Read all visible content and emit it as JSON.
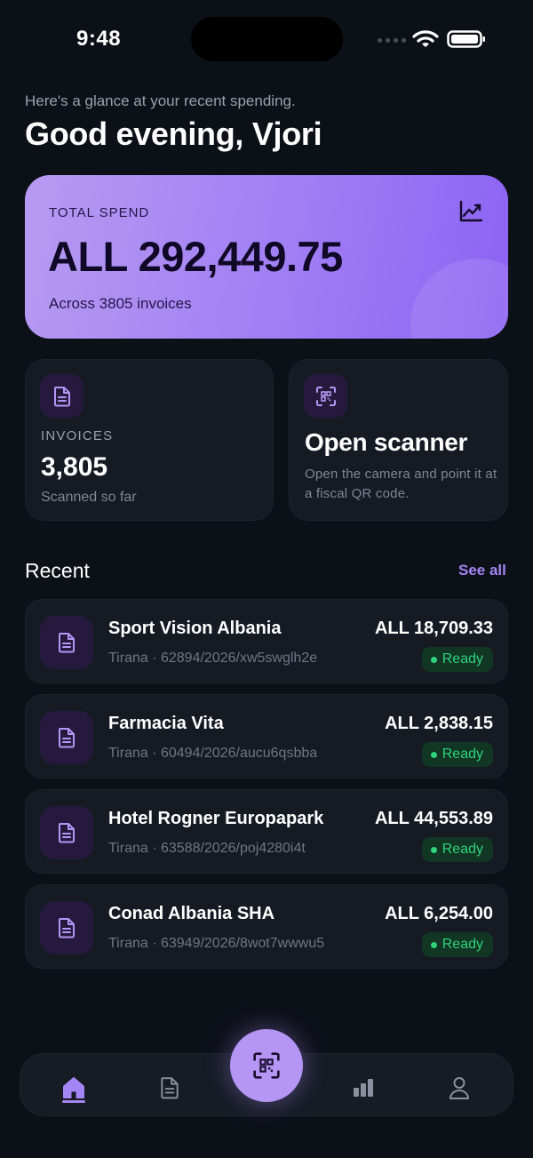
{
  "status_bar": {
    "time": "9:48"
  },
  "header": {
    "subtitle": "Here's a glance at your recent spending.",
    "greeting": "Good evening, Vjori"
  },
  "total_spend": {
    "label": "TOTAL SPEND",
    "amount": "ALL 292,449.75",
    "meta": "Across 3805 invoices",
    "icon": "trend-chart-icon"
  },
  "invoices_card": {
    "label": "INVOICES",
    "value": "3,805",
    "sub": "Scanned so far",
    "icon": "document-icon"
  },
  "scanner_card": {
    "title": "Open scanner",
    "description": "Open the camera and point it at a fiscal QR code.",
    "icon": "qr-scan-icon"
  },
  "recent": {
    "title": "Recent",
    "see_all": "See all",
    "items": [
      {
        "merchant": "Sport Vision Albania",
        "meta": "Tirana · 62894/2026/xw5swglh2e",
        "amount": "ALL 18,709.33",
        "status": "Ready"
      },
      {
        "merchant": "Farmacia Vita",
        "meta": "Tirana · 60494/2026/aucu6qsbba",
        "amount": "ALL 2,838.15",
        "status": "Ready"
      },
      {
        "merchant": "Hotel Rogner Europapark",
        "meta": "Tirana · 63588/2026/poj4280i4t",
        "amount": "ALL 44,553.89",
        "status": "Ready"
      },
      {
        "merchant": "Conad Albania SHA",
        "meta": "Tirana · 63949/2026/8wot7wwwu5",
        "amount": "ALL 6,254.00",
        "status": "Ready"
      }
    ]
  },
  "nav": {
    "items": [
      "home-icon",
      "document-icon",
      "qr-scan-icon",
      "bar-chart-icon",
      "profile-icon"
    ],
    "active": "home-icon"
  },
  "colors": {
    "background": "#0c1017",
    "accent": "#a485f5",
    "card": "#151a23",
    "ready": "#2fd37a"
  }
}
